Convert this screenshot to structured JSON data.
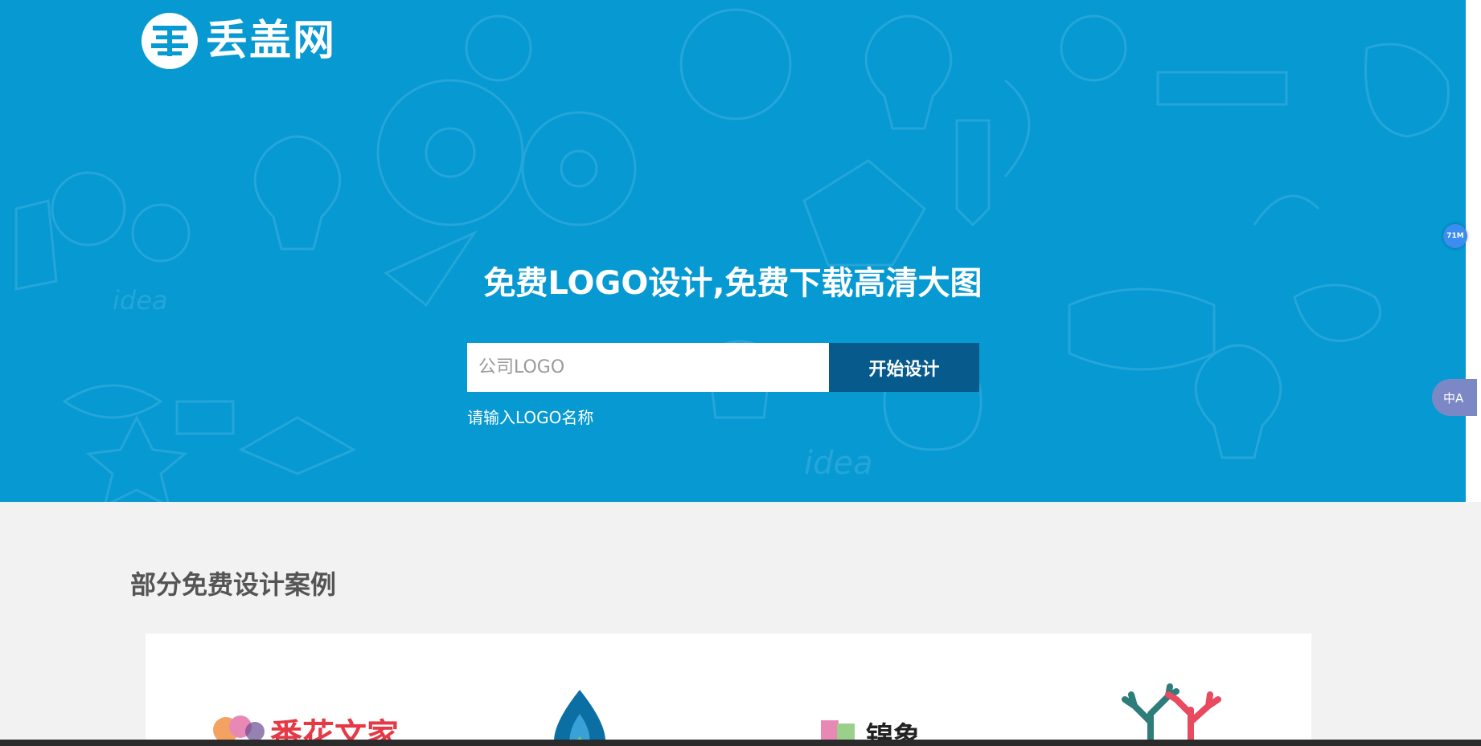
{
  "brand": {
    "name": "丢盖网"
  },
  "hero": {
    "headline": "免费LOGO设计,免费下载高清大图",
    "search": {
      "placeholder": "公司LOGO",
      "value": ""
    },
    "start_button": "开始设计",
    "hint": "请输入LOGO名称"
  },
  "side": {
    "badge": "71M",
    "translate_glyph": "中A"
  },
  "cases_section": {
    "title": "部分免费设计案例",
    "items": [
      {
        "label": "番花文家",
        "colors": [
          "#e63946",
          "#f4a261",
          "#6a4c93"
        ]
      },
      {
        "label": "",
        "colors": [
          "#0b6fa4",
          "#39a0d8",
          "#7bc96f"
        ]
      },
      {
        "label": "锦象",
        "colors": [
          "#e889b5",
          "#9bd08a",
          "#222222"
        ]
      },
      {
        "label": "",
        "colors": [
          "#2f7d7b",
          "#e84a5f"
        ]
      }
    ]
  },
  "colors": {
    "hero_bg": "#0699d2",
    "button_bg": "#065a8c",
    "page_bg": "#f2f2f2"
  }
}
